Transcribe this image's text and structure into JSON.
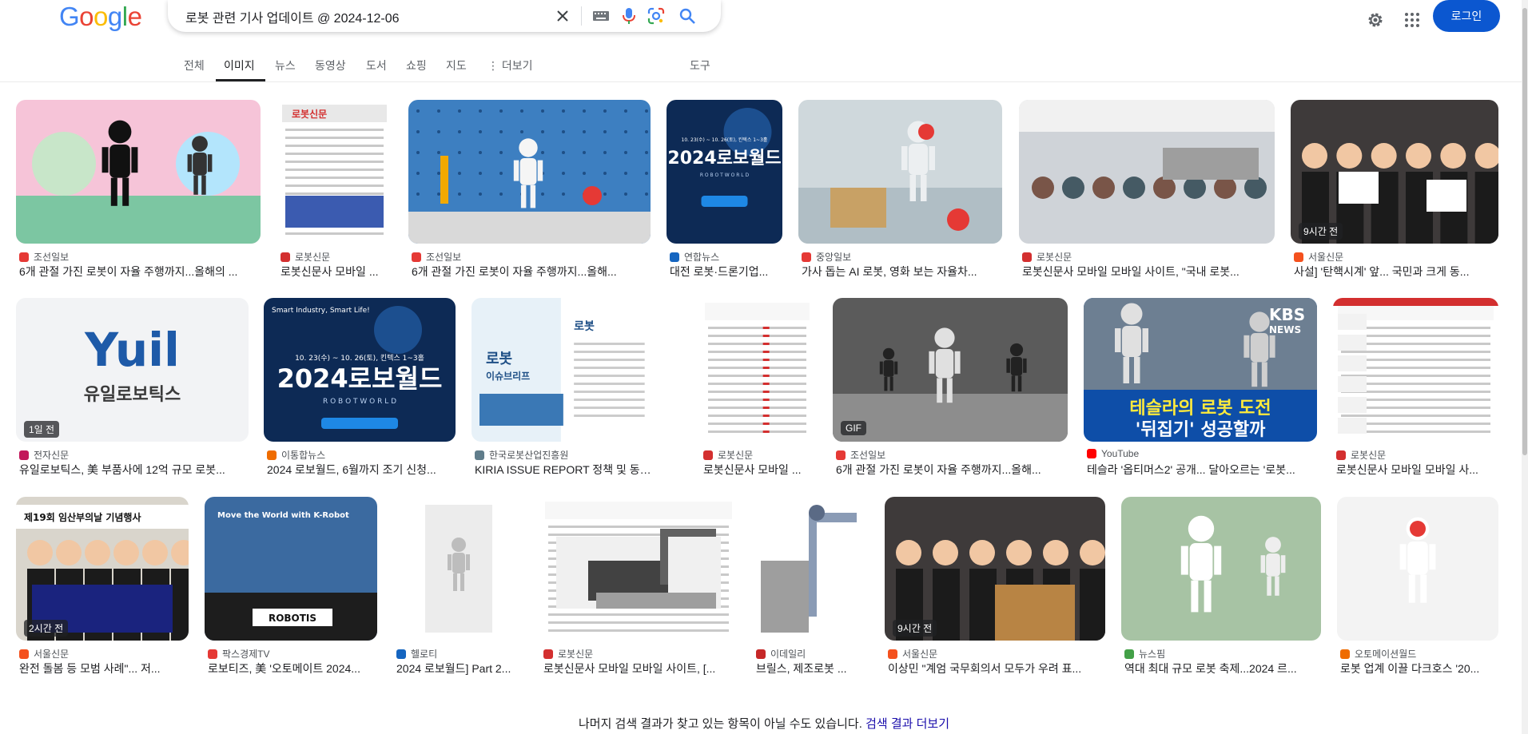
{
  "logo": {
    "text": "Google",
    "letters": [
      "G",
      "o",
      "o",
      "g",
      "l",
      "e"
    ],
    "colors": [
      "#4285f4",
      "#ea4335",
      "#fbbc05",
      "#4285f4",
      "#34a853",
      "#ea4335"
    ]
  },
  "search": {
    "query": "로봇 관련 기사 업데이트 @ 2024-12-06"
  },
  "header": {
    "login_label": "로그인"
  },
  "tabs": [
    "전체",
    "이미지",
    "뉴스",
    "동영상",
    "도서",
    "쇼핑",
    "지도",
    "⋮ 더보기",
    "도구"
  ],
  "results": [
    {
      "source": "조선일보",
      "title": "6개 관절 가진 로봇이 자율 주행까지...올해의 ...",
      "badge": "",
      "fav": "#e53935"
    },
    {
      "source": "로봇신문",
      "title": "로봇신문사 모바일 ...",
      "badge": "",
      "fav": "#d32f2f"
    },
    {
      "source": "조선일보",
      "title": "6개 관절 가진 로봇이 자율 주행까지...올해...",
      "badge": "",
      "fav": "#e53935"
    },
    {
      "source": "연합뉴스",
      "title": "대전 로봇·드론기업...",
      "badge": "",
      "fav": "#1565c0"
    },
    {
      "source": "중앙일보",
      "title": "가사 돕는 AI 로봇, 영화 보는 자율차...",
      "badge": "",
      "fav": "#e53935"
    },
    {
      "source": "로봇신문",
      "title": "로봇신문사 모바일 모바일 사이트, \"국내 로봇...",
      "badge": "",
      "fav": "#d32f2f"
    },
    {
      "source": "서울신문",
      "title": "사설] '탄핵시계' 앞... 국민과 크게 동...",
      "badge": "9시간 전",
      "fav": "#f4511e"
    },
    {
      "source": "전자신문",
      "title": "유일로보틱스, 美 부품사에 12억 규모 로봇...",
      "badge": "1일 전",
      "fav": "#c2185b"
    },
    {
      "source": "이통합뉴스",
      "title": "2024 로보월드, 6월까지 조기 신청...",
      "badge": "",
      "fav": "#ef6c00"
    },
    {
      "source": "한국로봇산업진흥원",
      "title": "KIRIA ISSUE REPORT 정책 및 동향...",
      "badge": "",
      "fav": "#607d8b"
    },
    {
      "source": "로봇신문",
      "title": "로봇신문사 모바일 ...",
      "badge": "",
      "fav": "#d32f2f"
    },
    {
      "source": "조선일보",
      "title": "6개 관절 가진 로봇이 자율 주행까지...올해...",
      "badge": "GIF",
      "fav": "#e53935"
    },
    {
      "source": "YouTube",
      "title": "테슬라 '옵티머스2' 공개... 달아오르는 '로봇...",
      "badge": "",
      "fav": "#ff0000"
    },
    {
      "source": "로봇신문",
      "title": "로봇신문사 모바일 모바일 사...",
      "badge": "",
      "fav": "#d32f2f"
    },
    {
      "source": "서울신문",
      "title": "완전 돌봄 등 모범 사례\"... 저...",
      "badge": "2시간 전",
      "fav": "#f4511e"
    },
    {
      "source": "팍스경제TV",
      "title": "로보티즈, 美 '오토메이트 2024...",
      "badge": "",
      "fav": "#e53935"
    },
    {
      "source": "헬로티",
      "title": "2024 로보월드] Part 2...",
      "badge": "",
      "fav": "#1565c0"
    },
    {
      "source": "로봇신문",
      "title": "로봇신문사 모바일 모바일 사이트, [...",
      "badge": "",
      "fav": "#d32f2f"
    },
    {
      "source": "이데일리",
      "title": "브릴스, 제조로봇 ...",
      "badge": "",
      "fav": "#c62828"
    },
    {
      "source": "서울신문",
      "title": "이상민 \"계엄 국무회의서 모두가 우려 표...",
      "badge": "9시간 전",
      "fav": "#f4511e"
    },
    {
      "source": "뉴스핌",
      "title": "역대 최대 규모 로봇 축제...2024 르...",
      "badge": "",
      "fav": "#43a047"
    },
    {
      "source": "오토메이션월드",
      "title": "로봇 업계 이끌 다크호스 '20...",
      "badge": "",
      "fav": "#ef6c00"
    }
  ],
  "thumb_text": {
    "yuil_logo": "Yuil",
    "yuil_name": "유일로보틱스",
    "robotworld_dates": "10. 23(수) ~ 10. 26(토), 킨텍스 1~3홀",
    "robotworld_title": "2024로보월드",
    "robotworld_sub": "R O B O T W O R L D",
    "robotworld_tag": "Smart Industry, Smart Life!",
    "kiria_title": "로봇",
    "kiria_sub": "이슈브리프",
    "kbs_logo": "KBS",
    "kbs_news": "NEWS",
    "tesla_line1": "테슬라의 로봇 도전",
    "tesla_line2": "'뒤집기' 성공할까",
    "robotis": "ROBOTIS",
    "move_world": "Move the World with K-Robot",
    "imsan": "제19회 임산부의날 기념행사",
    "robot_news_mast": "로봇신문"
  },
  "footer": {
    "message": "나머지 검색 결과가 찾고 있는 항목이 아닐 수도 있습니다.",
    "link": "검색 결과 더보기"
  }
}
